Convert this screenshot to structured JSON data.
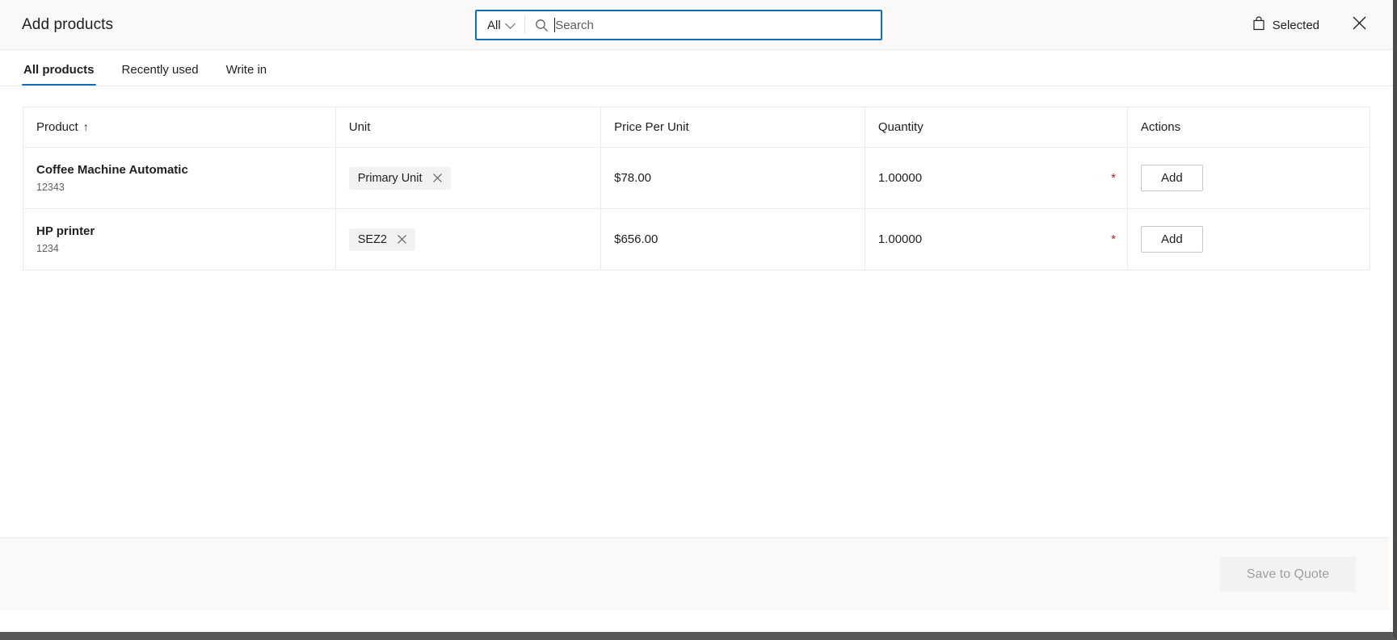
{
  "header": {
    "title": "Add products",
    "search": {
      "scope_label": "All",
      "scope_icon": "chevron-down-icon",
      "icon": "search-icon",
      "placeholder": "Search",
      "value": ""
    },
    "selected_label": "Selected",
    "selected_icon": "shopping-bag-icon",
    "close_icon": "close-icon",
    "accent_color": "#0f6cbd"
  },
  "tabs": [
    {
      "label": "All products",
      "active": true
    },
    {
      "label": "Recently used",
      "active": false
    },
    {
      "label": "Write in",
      "active": false
    }
  ],
  "table": {
    "columns": [
      {
        "label": "Product",
        "sort": "↑"
      },
      {
        "label": "Unit",
        "sort": ""
      },
      {
        "label": "Price Per Unit",
        "sort": ""
      },
      {
        "label": "Quantity",
        "sort": ""
      },
      {
        "label": "Actions",
        "sort": ""
      }
    ],
    "rows": [
      {
        "product_name": "Coffee Machine Automatic",
        "product_id": "12343",
        "unit": "Primary Unit",
        "unit_remove_icon": "close-icon",
        "price_per_unit": "$78.00",
        "quantity": "1.00000",
        "quantity_required_marker": "*",
        "action_label": "Add"
      },
      {
        "product_name": "HP printer",
        "product_id": "1234",
        "unit": "SEZ2",
        "unit_remove_icon": "close-icon",
        "price_per_unit": "$656.00",
        "quantity": "1.00000",
        "quantity_required_marker": "*",
        "action_label": "Add"
      }
    ]
  },
  "footer": {
    "save_label": "Save to Quote",
    "save_disabled": true
  }
}
